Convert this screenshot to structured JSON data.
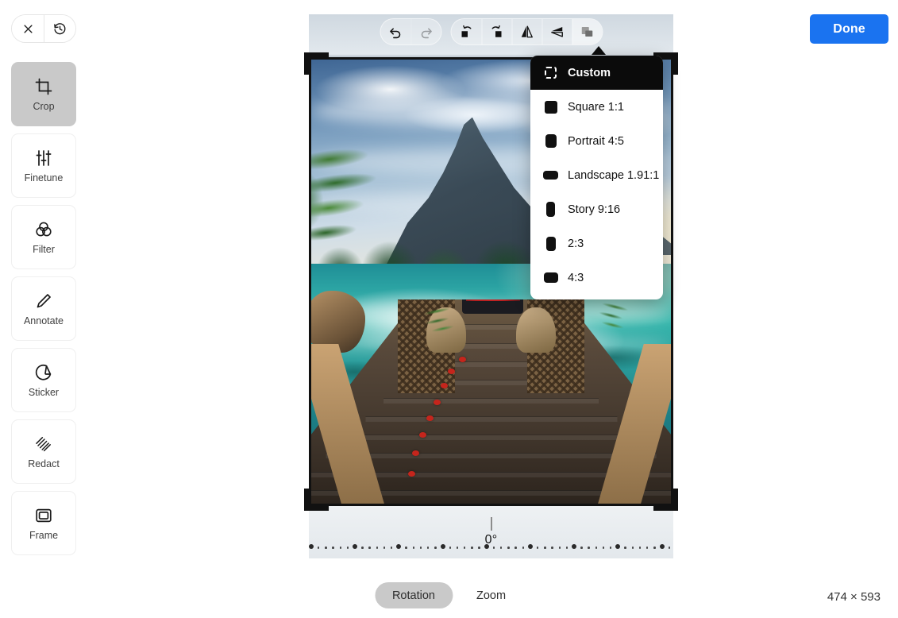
{
  "header": {
    "close_icon": "close-icon",
    "revert_icon": "history-revert-icon",
    "done_label": "Done"
  },
  "sidebar": {
    "items": [
      {
        "label": "Crop",
        "icon": "crop-icon",
        "active": true
      },
      {
        "label": "Finetune",
        "icon": "sliders-icon",
        "active": false
      },
      {
        "label": "Filter",
        "icon": "filter-icon",
        "active": false
      },
      {
        "label": "Annotate",
        "icon": "pencil-icon",
        "active": false
      },
      {
        "label": "Sticker",
        "icon": "sticker-icon",
        "active": false
      },
      {
        "label": "Redact",
        "icon": "redact-icon",
        "active": false
      },
      {
        "label": "Frame",
        "icon": "frame-icon",
        "active": false
      }
    ]
  },
  "toolbar": {
    "groups": [
      {
        "buttons": [
          {
            "name": "undo-button",
            "icon": "undo-icon",
            "enabled": true
          },
          {
            "name": "redo-button",
            "icon": "redo-icon",
            "enabled": false
          }
        ]
      },
      {
        "buttons": [
          {
            "name": "rotate-left-button",
            "icon": "rotate-left-icon",
            "enabled": true
          },
          {
            "name": "rotate-right-button",
            "icon": "rotate-right-icon",
            "enabled": true
          },
          {
            "name": "flip-horizontal-button",
            "icon": "flip-horizontal-icon",
            "enabled": true
          },
          {
            "name": "flip-vertical-button",
            "icon": "flip-vertical-icon",
            "enabled": true
          },
          {
            "name": "aspect-ratio-button",
            "icon": "aspect-ratio-icon",
            "enabled": true,
            "active": true
          }
        ]
      }
    ]
  },
  "aspect_menu": {
    "open": true,
    "items": [
      {
        "label": "Custom",
        "icon": "dashed-square-icon",
        "selected": true,
        "w": 15,
        "h": 15,
        "r": 3
      },
      {
        "label": "Square 1:1",
        "icon": "square-icon",
        "selected": false,
        "w": 16,
        "h": 16,
        "r": 3
      },
      {
        "label": "Portrait 4:5",
        "icon": "portrait-icon",
        "selected": false,
        "w": 14,
        "h": 17,
        "r": 4
      },
      {
        "label": "Landscape 1.91:1",
        "icon": "landscape-icon",
        "selected": false,
        "w": 19,
        "h": 11,
        "r": 4
      },
      {
        "label": "Story 9:16",
        "icon": "story-icon",
        "selected": false,
        "w": 11,
        "h": 19,
        "r": 4
      },
      {
        "label": "2:3",
        "icon": "ratio-2-3-icon",
        "selected": false,
        "w": 12,
        "h": 18,
        "r": 4
      },
      {
        "label": "4:3",
        "icon": "ratio-4-3-icon",
        "selected": false,
        "w": 18,
        "h": 13,
        "r": 4
      }
    ]
  },
  "rotation": {
    "value_label": "0°",
    "value": 0,
    "min": -45,
    "max": 45
  },
  "footer": {
    "modes": [
      {
        "label": "Rotation",
        "active": true
      },
      {
        "label": "Zoom",
        "active": false
      }
    ],
    "dimensions": "474 × 593"
  },
  "colors": {
    "accent": "#1a73f0",
    "active_pill": "#c9c9c9",
    "menu_selected_bg": "#0b0b0b",
    "crop_border": "#111111"
  },
  "image": {
    "alt": "tropical lagoon with mountain, palms and wooden pier at sunset"
  }
}
